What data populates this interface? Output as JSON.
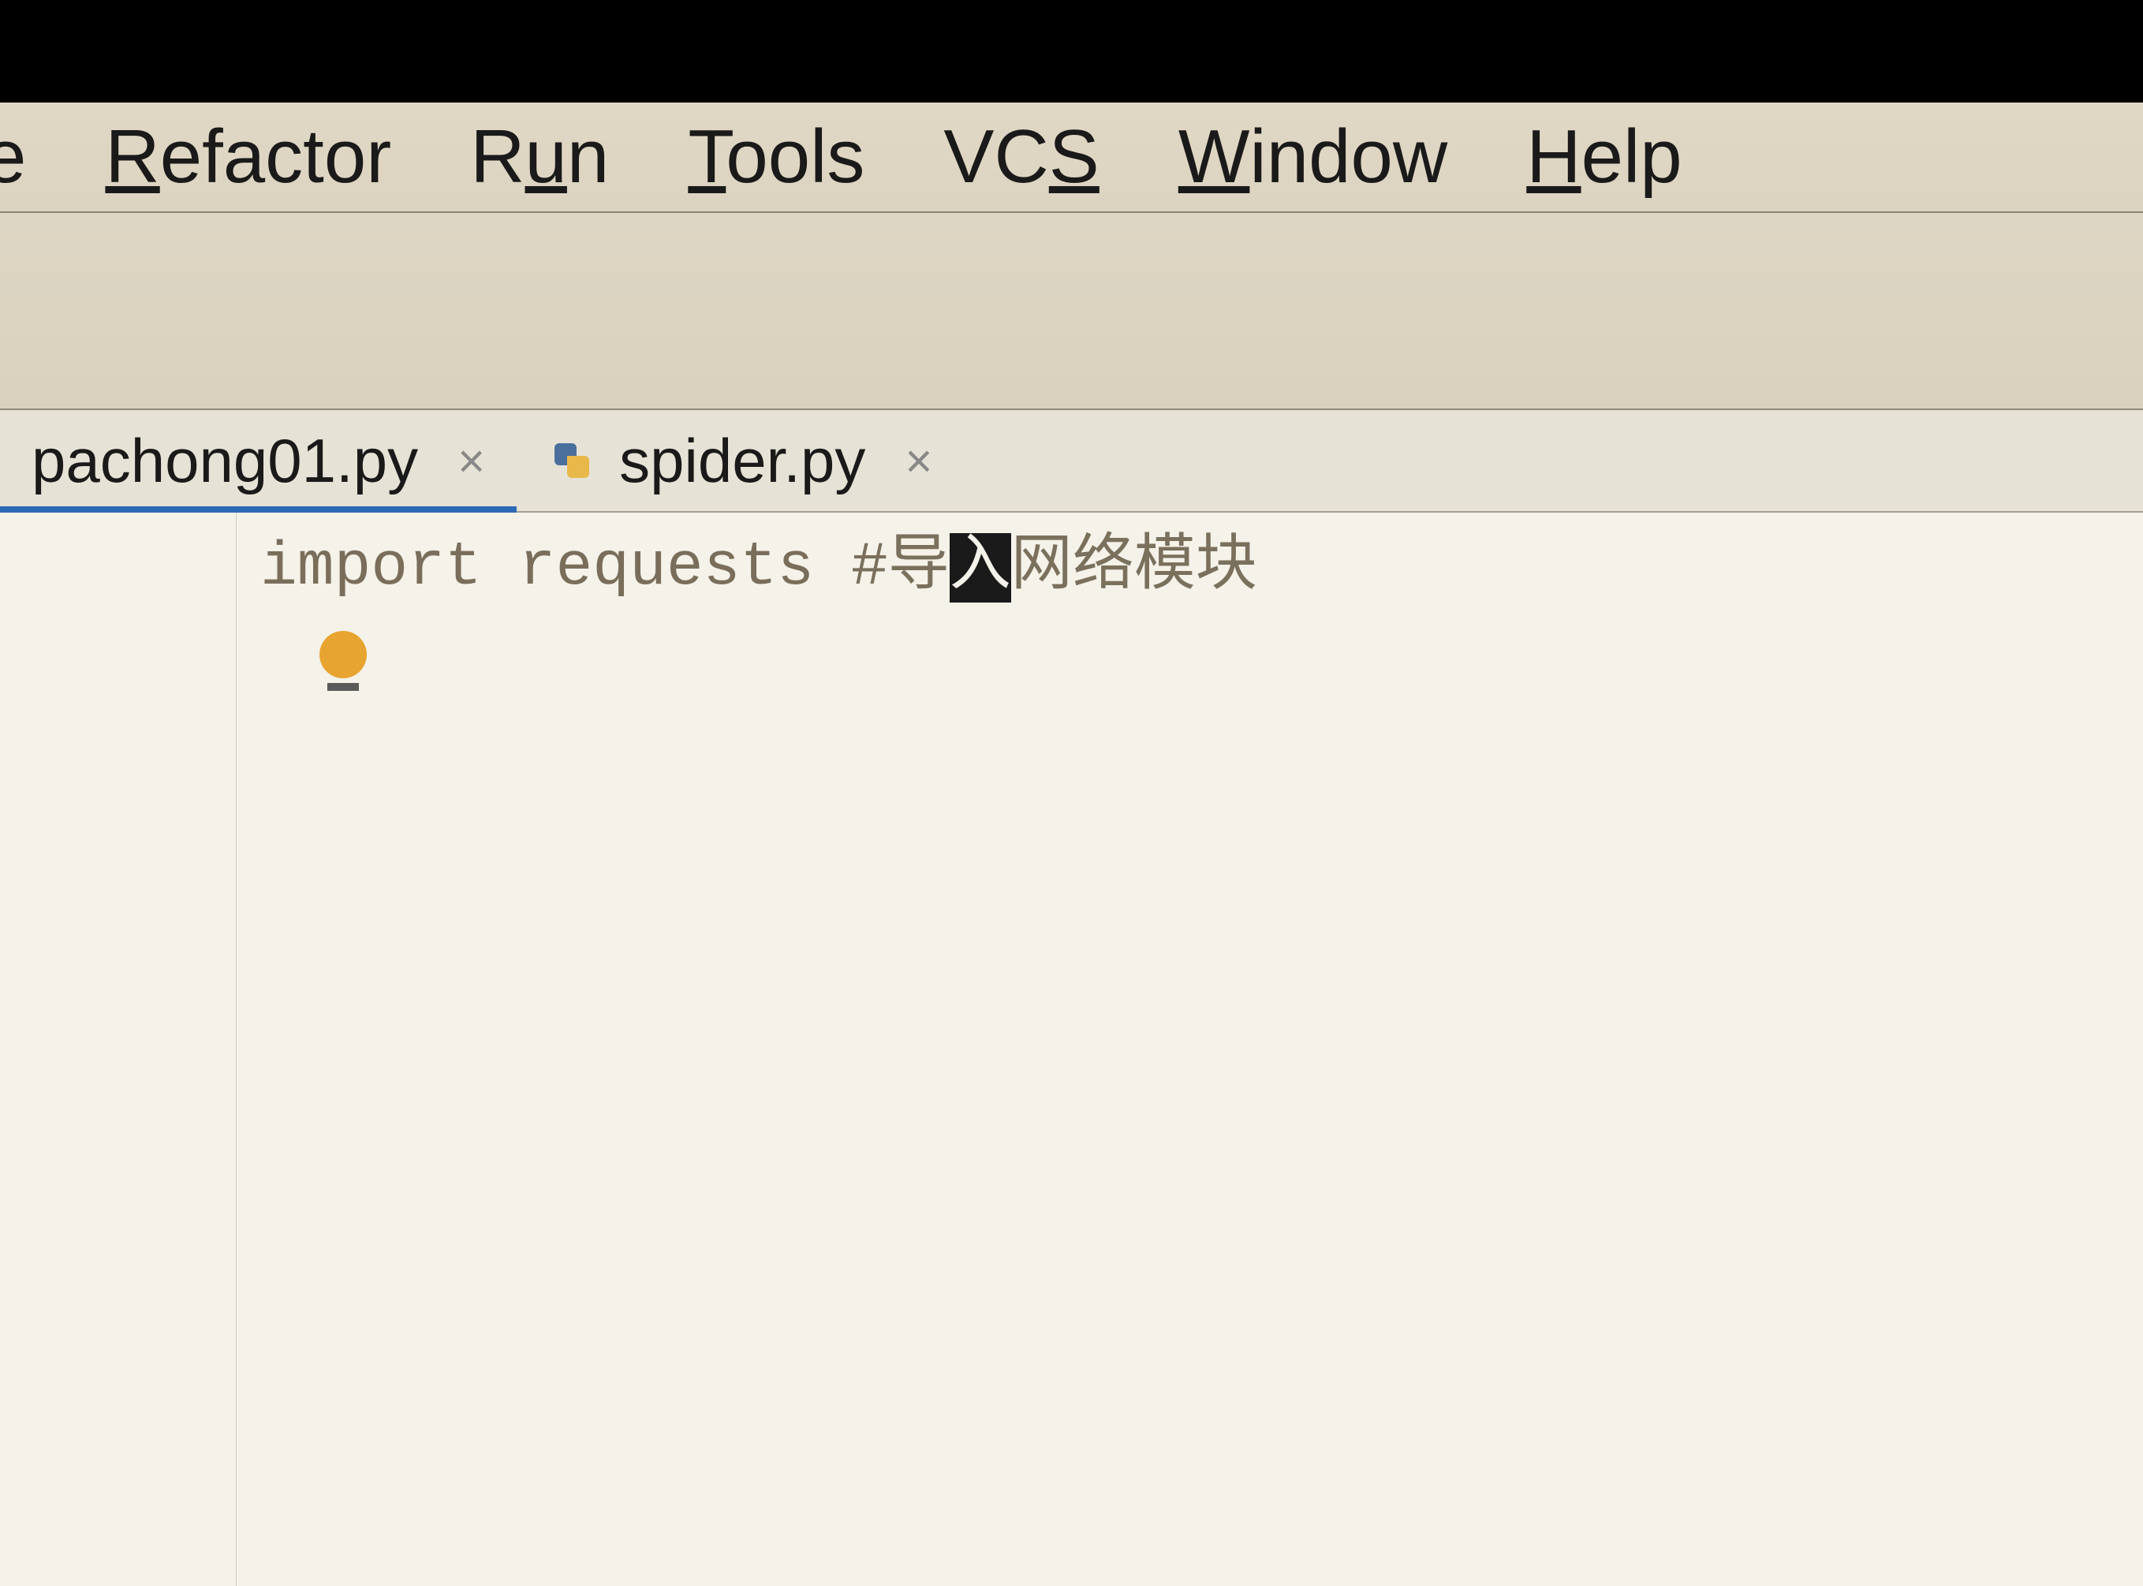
{
  "menubar": {
    "items": [
      {
        "prefix": "e",
        "label": "",
        "underline": ""
      },
      {
        "prefix": "",
        "underline": "R",
        "label": "efactor"
      },
      {
        "prefix": "R",
        "underline": "u",
        "label": "n"
      },
      {
        "prefix": "",
        "underline": "T",
        "label": "ools"
      },
      {
        "prefix": "VC",
        "underline": "S",
        "label": ""
      },
      {
        "prefix": "",
        "underline": "W",
        "label": "indow"
      },
      {
        "prefix": "",
        "underline": "H",
        "label": "elp"
      }
    ]
  },
  "tabs": [
    {
      "filename": "pachong01.py",
      "active": true
    },
    {
      "filename": "spider.py",
      "active": false
    }
  ],
  "editor": {
    "code_keyword": "import",
    "code_module": "requests",
    "comment_prefix": "#导",
    "comment_cursor": "入",
    "comment_suffix": "网络模块"
  }
}
